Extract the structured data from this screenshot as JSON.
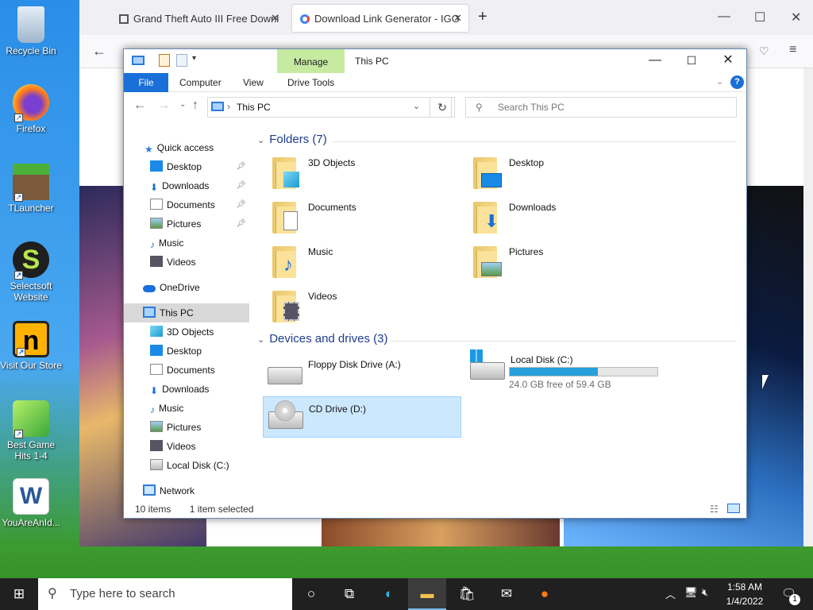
{
  "desktop": {
    "icons": [
      {
        "label": "Recycle Bin"
      },
      {
        "label": "Firefox"
      },
      {
        "label": "TLauncher"
      },
      {
        "label": "Selectsoft Website"
      },
      {
        "label": "Visit Our Store"
      },
      {
        "label": "Best Game Hits 1-4"
      },
      {
        "label": "YouAreAnId..."
      }
    ]
  },
  "browser": {
    "tabs": [
      {
        "title": "Grand Theft Auto III Free Downl"
      },
      {
        "title": "Download Link Generator - IGG"
      }
    ],
    "new_tab": "+"
  },
  "explorer": {
    "title": "This PC",
    "manage": "Manage",
    "ribbon_tabs": {
      "file": "File",
      "computer": "Computer",
      "view": "View",
      "drive_tools": "Drive Tools"
    },
    "address": "This PC",
    "search_placeholder": "Search This PC",
    "nav": {
      "quick_access": "Quick access",
      "qa_items": [
        "Desktop",
        "Downloads",
        "Documents",
        "Pictures",
        "Music",
        "Videos"
      ],
      "onedrive": "OneDrive",
      "this_pc": "This PC",
      "pc_items": [
        "3D Objects",
        "Desktop",
        "Documents",
        "Downloads",
        "Music",
        "Pictures",
        "Videos",
        "Local Disk (C:)"
      ],
      "network": "Network"
    },
    "folders_header": "Folders (7)",
    "folders": [
      "3D Objects",
      "Desktop",
      "Documents",
      "Downloads",
      "Music",
      "Pictures",
      "Videos"
    ],
    "devices_header": "Devices and drives (3)",
    "drives": [
      {
        "name": "Floppy Disk Drive (A:)"
      },
      {
        "name": "Local Disk (C:)",
        "free": "24.0 GB free of 59.4 GB",
        "used_fraction": 0.596
      },
      {
        "name": "CD Drive (D:)"
      }
    ],
    "status_items": "10 items",
    "status_selected": "1 item selected"
  },
  "taskbar": {
    "search_placeholder": "Type here to search",
    "time": "1:58 AM",
    "date": "1/4/2022",
    "notification_count": "1"
  },
  "colors": {
    "accent": "#1a6fd8",
    "manage": "#c6eaa0",
    "selected": "#cce8ff",
    "taskbar": "#202020"
  }
}
